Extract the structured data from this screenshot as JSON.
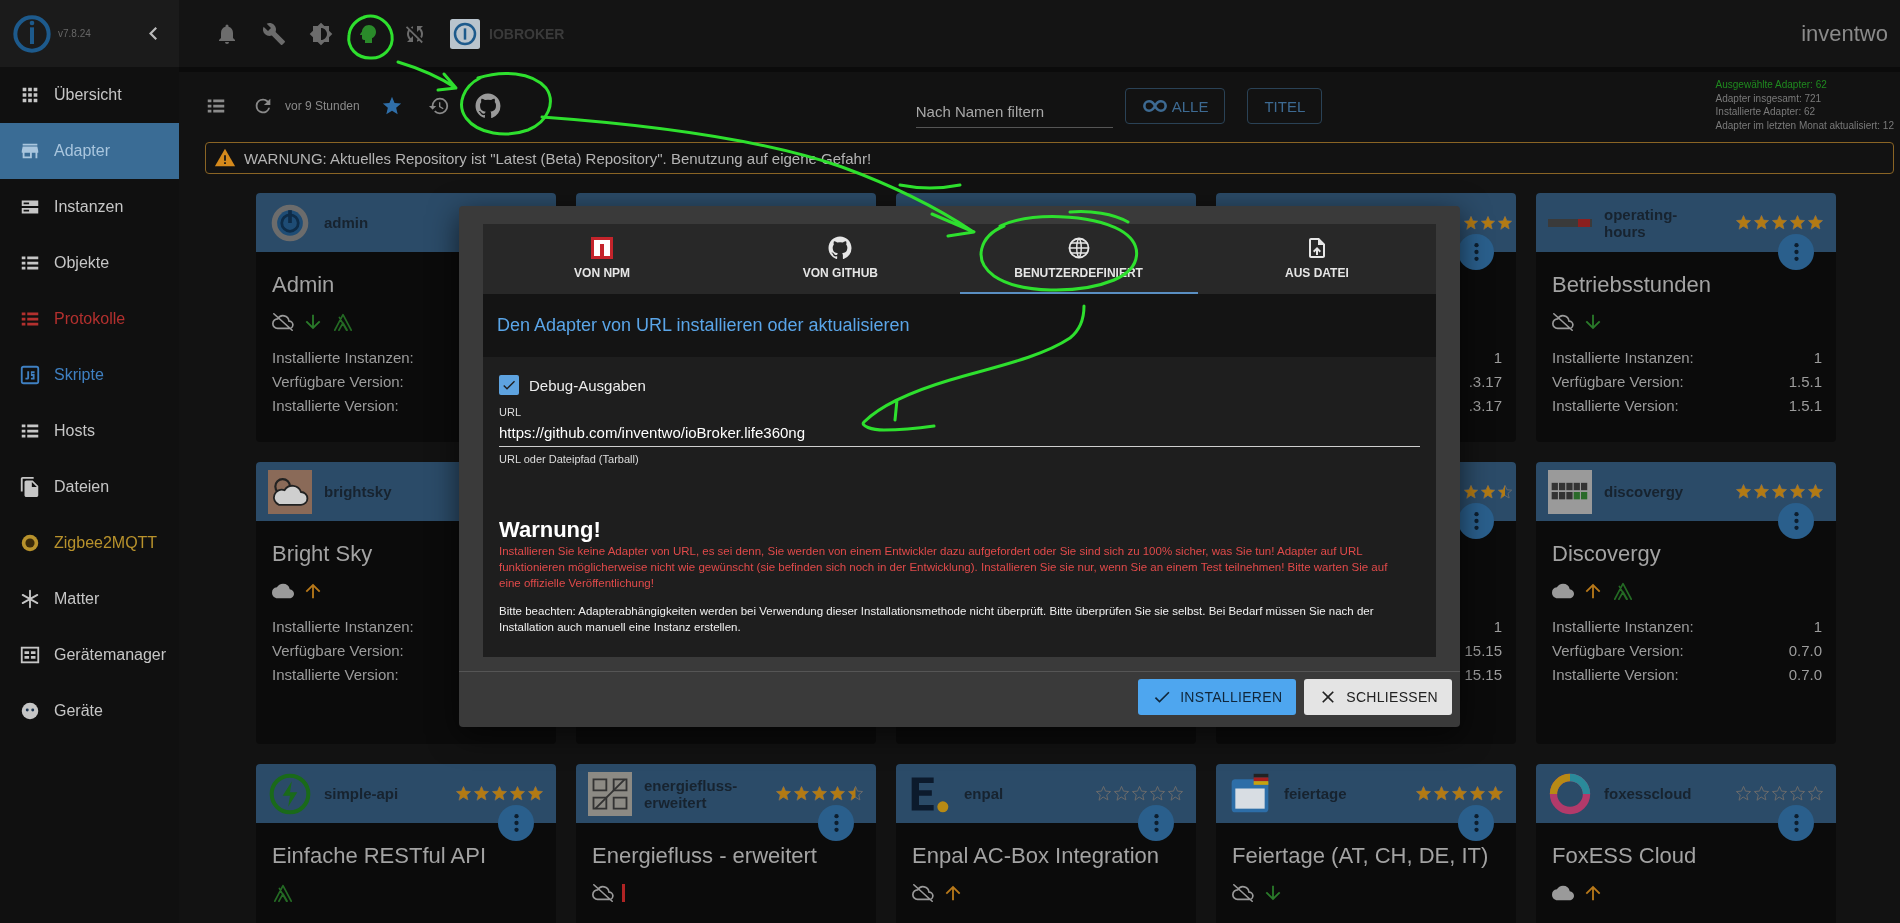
{
  "sidebar": {
    "version": "v7.8.24",
    "items": [
      {
        "label": "Übersicht",
        "selected": false,
        "color": "#c6c6c6"
      },
      {
        "label": "Adapter",
        "selected": true,
        "color": "#a9c6de"
      },
      {
        "label": "Instanzen",
        "selected": false,
        "color": "#c6c6c6"
      },
      {
        "label": "Objekte",
        "selected": false,
        "color": "#c6c6c6"
      },
      {
        "label": "Protokolle",
        "selected": false,
        "color": "#b3302e"
      },
      {
        "label": "Skripte",
        "selected": false,
        "color": "#3f80c2"
      },
      {
        "label": "Hosts",
        "selected": false,
        "color": "#c6c6c6"
      },
      {
        "label": "Dateien",
        "selected": false,
        "color": "#c6c6c6"
      },
      {
        "label": "Zigbee2MQTT",
        "selected": false,
        "color": "#b8922c"
      },
      {
        "label": "Matter",
        "selected": false,
        "color": "#c6c6c6"
      },
      {
        "label": "Gerätemanager",
        "selected": false,
        "color": "#c6c6c6"
      },
      {
        "label": "Geräte",
        "selected": false,
        "color": "#c6c6c6"
      }
    ]
  },
  "topbar": {
    "brand": "IOBROKER",
    "user": "inventwo"
  },
  "toolbar": {
    "updated": "vor 9 Stunden",
    "filter": {
      "placeholder": "Nach Namen filtern"
    },
    "buttons": [
      {
        "label": "ALLE",
        "kind": "all"
      },
      {
        "label": "TITEL",
        "kind": "plain"
      }
    ],
    "stats": [
      {
        "text": "Ausgewählte Adapter: 62",
        "color": "#1f8a1f"
      },
      {
        "text": "Adapter insgesamt: 721",
        "color": "#7a7a7a"
      },
      {
        "text": "Installierte Adapter: 62",
        "color": "#7a7a7a"
      },
      {
        "text": "Adapter im letzten Monat aktualisiert: 12",
        "color": "#7a7a7a"
      }
    ]
  },
  "warning": "WARNUNG: Aktuelles Repository ist \"Latest (Beta) Repository\". Benutzung auf eigene Gefahr!",
  "cards": [
    {
      "kind": "left",
      "name": "admin",
      "title": "Admin",
      "icons": [
        {
          "kind": "cloud-off"
        },
        {
          "kind": "down"
        },
        {
          "kind": "sentry"
        }
      ],
      "info": [
        {
          "label": "Installierte Instanzen:"
        },
        {
          "label": "Verfügbare Version:"
        },
        {
          "label": "Installierte Version:"
        }
      ]
    },
    {
      "kind": "covered"
    },
    {
      "kind": "covered"
    },
    {
      "kind": "right",
      "stars": 3,
      "info": [
        {
          "value": "1"
        },
        {
          "value": ".3.17"
        },
        {
          "value": ".3.17"
        }
      ]
    },
    {
      "kind": "full",
      "name": "operating-hours",
      "stars": 5,
      "title": "Betriebsstunden",
      "icons": [
        {
          "kind": "cloud-off"
        },
        {
          "kind": "down"
        }
      ],
      "info": [
        {
          "label": "Installierte Instanzen:",
          "value": "1"
        },
        {
          "label": "Verfügbare Version:",
          "value": "1.5.1"
        },
        {
          "label": "Installierte Version:",
          "value": "1.5.1"
        }
      ]
    },
    {
      "kind": "left",
      "name": "brightsky",
      "title": "Bright Sky",
      "icons": [
        {
          "kind": "cloud"
        },
        {
          "kind": "up"
        }
      ],
      "info": [
        {
          "label": "Installierte Instanzen:"
        },
        {
          "label": "Verfügbare Version:"
        },
        {
          "label": "Installierte Version:"
        }
      ]
    },
    {
      "kind": "hidden"
    },
    {
      "kind": "hidden"
    },
    {
      "kind": "right",
      "stars": 2.5,
      "info": [
        {
          "value": "1"
        },
        {
          "value": "15.15"
        },
        {
          "value": "15.15"
        }
      ]
    },
    {
      "kind": "full",
      "name": "discovergy",
      "stars": 5,
      "title": "Discovergy",
      "icons": [
        {
          "kind": "cloud"
        },
        {
          "kind": "up"
        },
        {
          "kind": "sentry"
        }
      ],
      "info": [
        {
          "label": "Installierte Instanzen:",
          "value": "1"
        },
        {
          "label": "Verfügbare Version:",
          "value": "0.7.0"
        },
        {
          "label": "Installierte Version:",
          "value": "0.7.0"
        }
      ]
    },
    {
      "kind": "full",
      "name": "simple-api",
      "stars": 5,
      "title": "Einfache RESTful API",
      "icons": [
        {
          "kind": "sentry"
        }
      ]
    },
    {
      "kind": "full",
      "name": "energiefluss-erweitert",
      "stars": 4.5,
      "title": "Energiefluss - erweitert",
      "icons": [
        {
          "kind": "cloud-off"
        },
        {
          "kind": "bar"
        }
      ]
    },
    {
      "kind": "full",
      "name": "enpal",
      "stars": 0,
      "title": "Enpal AC-Box Integration",
      "icons": [
        {
          "kind": "cloud-off"
        },
        {
          "kind": "up"
        }
      ]
    },
    {
      "kind": "full",
      "name": "feiertage",
      "stars": 5,
      "title": "Feiertage (AT, CH, DE, IT)",
      "icons": [
        {
          "kind": "cloud-off"
        },
        {
          "kind": "down"
        }
      ]
    },
    {
      "kind": "full",
      "name": "foxesscloud",
      "stars": 0,
      "title": "FoxESS Cloud",
      "icons": [
        {
          "kind": "cloud"
        },
        {
          "kind": "up"
        }
      ]
    }
  ],
  "dialog": {
    "tabs": [
      {
        "label": "VON NPM",
        "selected": false
      },
      {
        "label": "VON GITHUB",
        "selected": false
      },
      {
        "label": "BENUTZERDEFINIERT",
        "selected": true
      },
      {
        "label": "AUS DATEI",
        "selected": false
      }
    ],
    "heading": "Den Adapter von URL installieren oder aktualisieren",
    "debug": {
      "label": "Debug-Ausgaben",
      "checked": true
    },
    "url": {
      "label": "URL",
      "value": "https://github.com/inventwo/ioBroker.life360ng",
      "helper": "URL oder Dateipfad (Tarball)"
    },
    "warning_title": "Warnung!",
    "warning_text": "Installieren Sie keine Adapter von URL, es sei denn, Sie werden von einem Entwickler dazu aufgefordert oder Sie sind sich zu 100% sicher, was Sie tun! Adapter auf URL funktionieren möglicherweise nicht wie gewünscht (sie befinden sich noch in der Entwicklung). Installieren Sie sie nur, wenn Sie an einem Test teilnehmen! Bitte warten Sie auf eine offizielle Veröffentlichung!",
    "note": "Bitte beachten: Adapterabhängigkeiten werden bei Verwendung dieser Installationsmethode nicht überprüft. Bitte überprüfen Sie sie selbst. Bei Bedarf müssen Sie nach der Installation auch manuell eine Instanz erstellen.",
    "buttons": [
      {
        "label": "INSTALLIEREN",
        "kind": "primary"
      },
      {
        "label": "SCHLIESSEN",
        "kind": "secondary"
      }
    ]
  }
}
